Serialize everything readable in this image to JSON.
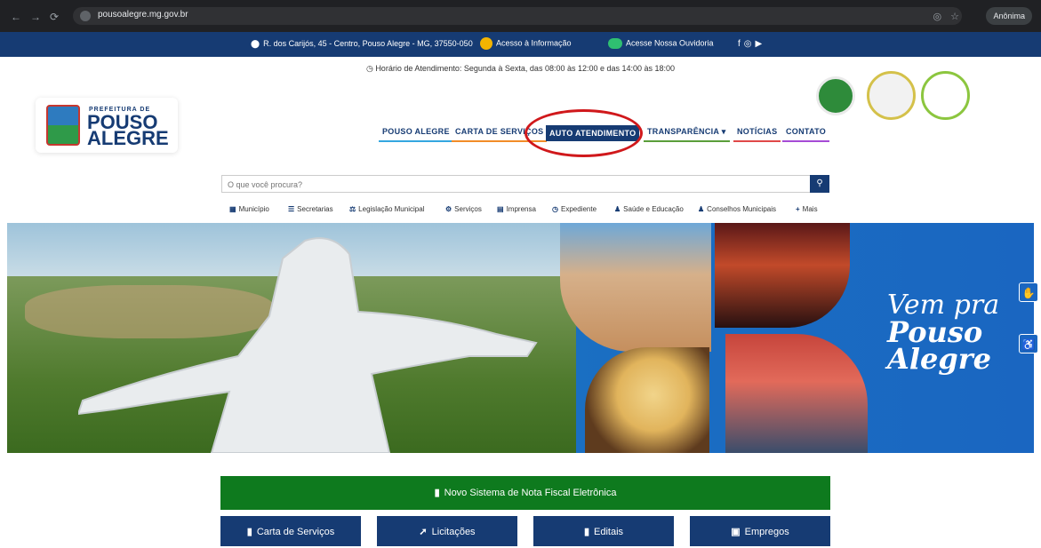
{
  "browser": {
    "url": "pousoalegre.mg.gov.br",
    "incognito_label": "Anônima"
  },
  "topbar": {
    "address": "R. dos Carijós, 45 - Centro, Pouso Alegre - MG, 37550-050",
    "info_access": "Acesso à Informação",
    "ombudsman": "Acesse Nossa Ouvidoria",
    "social_icons": [
      "facebook-icon",
      "instagram-icon",
      "youtube-icon"
    ]
  },
  "hours": "Horário de Atendimento: Segunda à Sexta, das 08:00 às 12:00 e das 14:00 às 18:00",
  "logo": {
    "line1": "PREFEITURA DE",
    "line2": "POUSO",
    "line3": "ALEGRE"
  },
  "nav": {
    "items": [
      {
        "label": "POUSO ALEGRE"
      },
      {
        "label": "CARTA DE SERVIÇOS"
      },
      {
        "label": "AUTO ATENDIMENTO"
      },
      {
        "label": "TRANSPARÊNCIA ▾"
      },
      {
        "label": "NOTÍCIAS"
      },
      {
        "label": "CONTATO"
      }
    ],
    "active": "AUTO ATENDIMENTO",
    "highlight_color": "#d0181b"
  },
  "search": {
    "placeholder": "O que você procura?"
  },
  "quicklinks": [
    {
      "label": "Município"
    },
    {
      "label": "Secretarias"
    },
    {
      "label": "Legislação Municipal"
    },
    {
      "label": "Serviços"
    },
    {
      "label": "Imprensa"
    },
    {
      "label": "Expediente"
    },
    {
      "label": "Saúde e Educação"
    },
    {
      "label": "Conselhos Municipais"
    },
    {
      "label": "Mais"
    }
  ],
  "banner": {
    "line1": "Vem pra",
    "line2": "Pouso",
    "line3": "Alegre"
  },
  "buttons": {
    "nfe": "Novo Sistema de Nota Fiscal Eletrônica",
    "cards": [
      {
        "label": "Carta de Serviços"
      },
      {
        "label": "Licitações"
      },
      {
        "label": "Editais"
      },
      {
        "label": "Empregos"
      }
    ]
  },
  "colors": {
    "primary": "#163b73",
    "green": "#0e7a1e"
  }
}
